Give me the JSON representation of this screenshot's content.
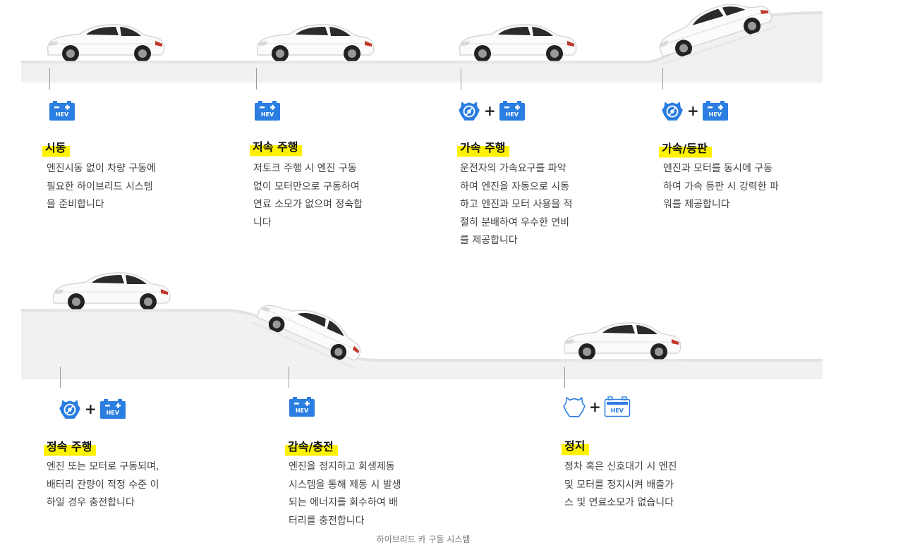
{
  "colors": {
    "accent": "#2a7de1",
    "highlight": "#fff200",
    "road": "#f1f1f1"
  },
  "stages": [
    {
      "title": "시동",
      "desc": "엔진시동 없이 차량 구동에\n필요한 하이브리드 시스템\n을 준비합니다",
      "icons": [
        "battery-hev-icon"
      ]
    },
    {
      "title": "저속 주행",
      "desc": "저토크 주행 시 엔진 구동\n없이 모터만으로 구동하여\n연료 소모가 없으며 정숙합\n니다",
      "icons": [
        "battery-hev-icon"
      ]
    },
    {
      "title": "가속 주행",
      "desc": "운전자의 가속요구를 파악\n하여 엔진을 자동으로 시동\n하고 엔진과 모터 사용을 적\n절히 분배하여 우수한 연비\n를 제공합니다",
      "icons": [
        "engine-icon",
        "battery-hev-icon"
      ]
    },
    {
      "title": "가속/등판",
      "desc": "엔진과 모터를 동시에 구동\n하여 가속 등판 시 강력한 파\n워를 제공합니다",
      "icons": [
        "engine-icon",
        "battery-hev-icon"
      ]
    },
    {
      "title": "정속 주행",
      "desc": "엔진 또는 모터로 구동되며,\n배터리 잔량이 적정 수준 이\n하일 경우 충전합니다",
      "icons": [
        "engine-icon",
        "battery-hev-icon"
      ]
    },
    {
      "title": "감속/충전",
      "desc": "엔진을 정지하고 회생제동\n시스템을 통해 제동 시 발생\n되는 에너지를 회수하여 배\n터리를 충전합니다",
      "icons": [
        "battery-hev-icon"
      ]
    },
    {
      "title": "정지",
      "desc": "정차 혹은 신호대기 시 엔진\n및 모터를 정지시켜 배출가\n스 및 연료소모가 없습니다",
      "icons": [
        "engine-outline-icon",
        "battery-hev-outline-icon"
      ]
    }
  ],
  "plus_sign": "+",
  "battery_label": "HEV",
  "caption": "하이브리드 카 구동 시스템"
}
